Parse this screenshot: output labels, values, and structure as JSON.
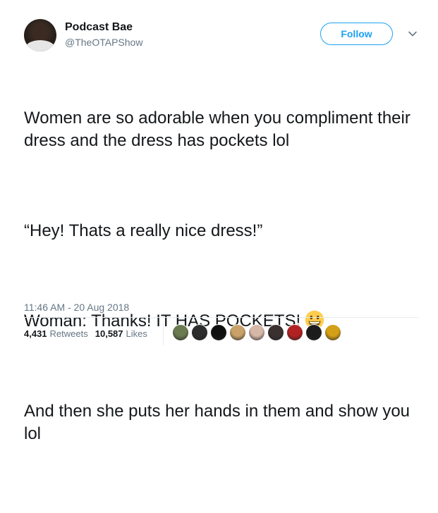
{
  "user": {
    "display_name": "Podcast Bae",
    "handle": "@TheOTAPShow"
  },
  "follow_label": "Follow",
  "tweet": {
    "paragraphs": [
      "Women are so adorable when you compliment their dress and the dress has pockets lol",
      "“Hey! Thats a really nice dress!”",
      "Woman: Thanks! IT HAS POCKETS!",
      "And then she puts her hands in them and show you lol"
    ],
    "emoji": "grinning-face-emoji"
  },
  "timestamp": "11:46 AM - 20 Aug 2018",
  "stats": {
    "retweets_count": "4,431",
    "retweets_label": "Retweets",
    "likes_count": "10,587",
    "likes_label": "Likes"
  },
  "likers": [
    {
      "color": "#6b7a4f"
    },
    {
      "color": "#2d2d2d"
    },
    {
      "color": "#101010"
    },
    {
      "color": "#c9a26a"
    },
    {
      "color": "#d7b7a8"
    },
    {
      "color": "#3a3030"
    },
    {
      "color": "#b22222"
    },
    {
      "color": "#1c1c1c"
    },
    {
      "color": "#d4a017"
    }
  ],
  "colors": {
    "accent": "#1da1f2",
    "secondary_text": "#657786",
    "primary_text": "#14171a"
  }
}
